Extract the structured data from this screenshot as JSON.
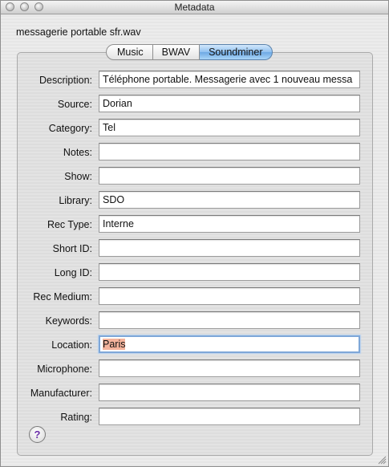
{
  "window": {
    "title": "Metadata"
  },
  "file": {
    "name": "messagerie portable sfr.wav"
  },
  "tabs": [
    {
      "label": "Music",
      "selected": false
    },
    {
      "label": "BWAV",
      "selected": false
    },
    {
      "label": "Soundminer",
      "selected": true
    }
  ],
  "fields": [
    {
      "label": "Description:",
      "value": "Téléphone portable. Messagerie avec 1 nouveau messa"
    },
    {
      "label": "Source:",
      "value": "Dorian"
    },
    {
      "label": "Category:",
      "value": "Tel"
    },
    {
      "label": "Notes:",
      "value": ""
    },
    {
      "label": "Show:",
      "value": ""
    },
    {
      "label": "Library:",
      "value": "SDO"
    },
    {
      "label": "Rec Type:",
      "value": "Interne"
    },
    {
      "label": "Short ID:",
      "value": ""
    },
    {
      "label": "Long ID:",
      "value": ""
    },
    {
      "label": "Rec Medium:",
      "value": ""
    },
    {
      "label": "Keywords:",
      "value": ""
    },
    {
      "label": "Location:",
      "value": "Paris"
    },
    {
      "label": "Microphone:",
      "value": ""
    },
    {
      "label": "Manufacturer:",
      "value": ""
    },
    {
      "label": "Rating:",
      "value": ""
    }
  ],
  "help": {
    "glyph": "?"
  },
  "colors": {
    "selection": "#f4b39c",
    "focus_ring": "#7ea7d8",
    "help_glyph": "#6a2fa8"
  }
}
